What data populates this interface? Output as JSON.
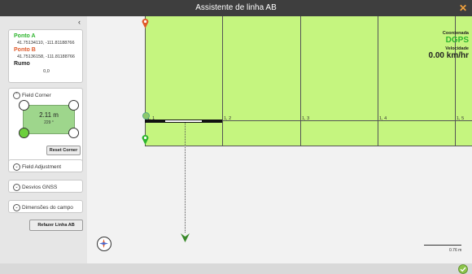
{
  "window": {
    "title": "Assistente de linha AB",
    "close_glyph": "✕"
  },
  "sidebar": {
    "collapse_glyph": "‹",
    "points": {
      "a_label": "Ponto A",
      "a_coords": "41.75134110, -111.81188766",
      "b_label": "Ponto B",
      "b_coords": "41.75136158, -111.81188766",
      "heading_label": "Rumo",
      "heading_value": "0,0"
    },
    "field_corner": {
      "title": "Field Corner",
      "distance": "2.11 m",
      "angle": "229 °",
      "reset_label": "Reset Corner"
    },
    "sections": {
      "field_adjustment": "Field Adjustment",
      "gnss_offsets": "Desvios GNSS",
      "field_dimensions": "Dimensões do campo"
    },
    "redo_label": "Refazer Linha AB"
  },
  "map": {
    "rows": [
      "1, 1",
      "1, 2",
      "1, 3",
      "1, 4",
      "1, 5"
    ],
    "status": {
      "coord_label": "Coordenada",
      "coord_value": "DGPS",
      "speed_label": "Velocidade",
      "speed_value": "0.00 km/hr"
    },
    "scale_label": "0.76 m"
  },
  "colors": {
    "field": "#c5f57f",
    "point_a": "#2db52d",
    "point_b": "#e05a2a",
    "confirm": "#8bc34a"
  }
}
